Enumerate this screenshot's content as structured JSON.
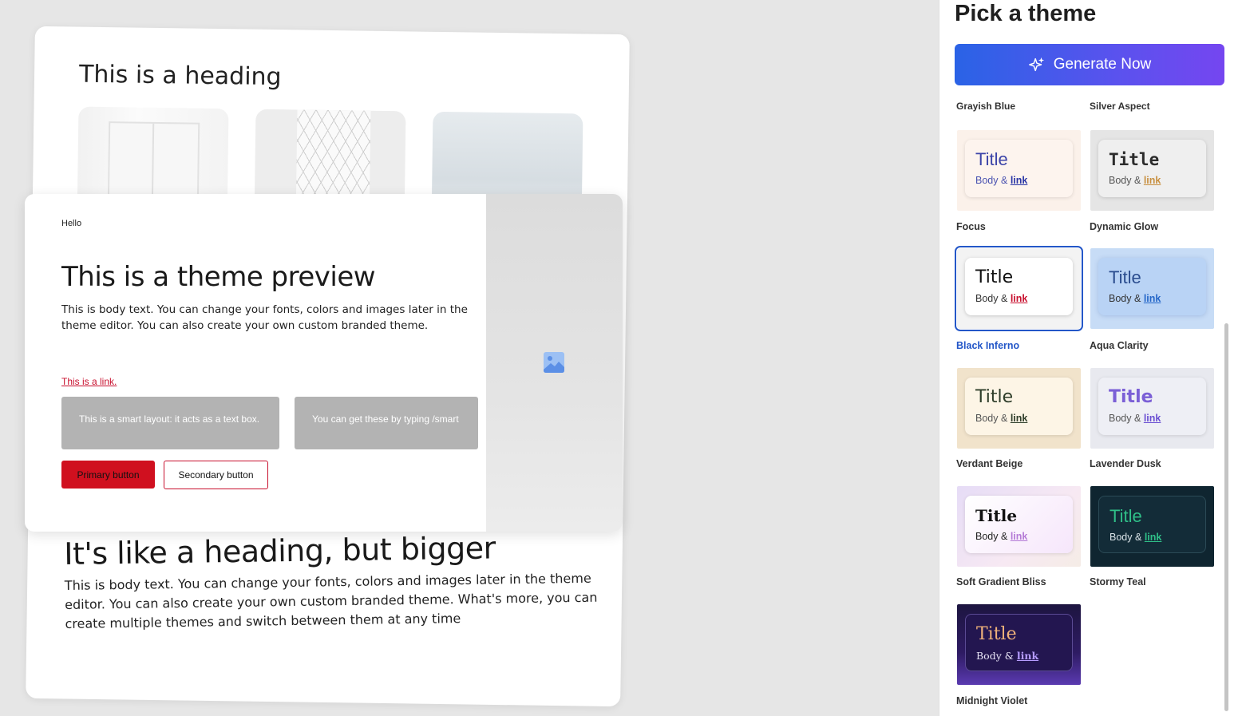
{
  "preview": {
    "background_heading": "This is a heading",
    "hello": "Hello",
    "title": "This is a theme preview",
    "body": "This is body text. You can change your fonts, colors and images later in the theme editor. You can also create your own custom branded theme.",
    "link": "This is a link.",
    "smart_box_1": "This is a smart layout: it acts as a text box.",
    "smart_box_2": "You can get these by typing /smart",
    "primary_button": "Primary button",
    "secondary_button": "Secondary button",
    "image_icon": "image-placeholder-icon",
    "big_heading": "It's like a heading, but bigger",
    "big_body": "This is body text. You can change your fonts, colors and images later in the theme editor. You can also create your own custom branded theme. What's more, you can create multiple themes and switch between them at any time"
  },
  "panel": {
    "title": "Pick a theme",
    "generate_label": "Generate Now",
    "generate_icon": "sparkle-icon",
    "partial_labels": [
      "Grayish Blue",
      "Silver Aspect"
    ],
    "selected_theme": "Black Inferno",
    "themes": [
      {
        "name": "Focus",
        "title": "Title",
        "body": "Body",
        "amp": "&",
        "link": "link"
      },
      {
        "name": "Dynamic Glow",
        "title": "Title",
        "body": "Body",
        "amp": "&",
        "link": "link"
      },
      {
        "name": "Black Inferno",
        "title": "Title",
        "body": "Body",
        "amp": "&",
        "link": "link"
      },
      {
        "name": "Aqua Clarity",
        "title": "Title",
        "body": "Body",
        "amp": "&",
        "link": "link"
      },
      {
        "name": "Verdant Beige",
        "title": "Title",
        "body": "Body",
        "amp": "&",
        "link": "link"
      },
      {
        "name": "Lavender Dusk",
        "title": "Title",
        "body": "Body",
        "amp": "&",
        "link": "link"
      },
      {
        "name": "Soft Gradient Bliss",
        "title": "Title",
        "body": "Body",
        "amp": "&",
        "link": "link"
      },
      {
        "name": "Stormy Teal",
        "title": "Title",
        "body": "Body",
        "amp": "&",
        "link": "link"
      },
      {
        "name": "Midnight Violet",
        "title": "Title",
        "body": "Body",
        "amp": "&",
        "link": "link"
      }
    ]
  },
  "colors": {
    "accent": "#2457c8",
    "preview_primary": "#d0101f",
    "generate_gradient_start": "#2a63e6",
    "generate_gradient_end": "#7546f0"
  }
}
